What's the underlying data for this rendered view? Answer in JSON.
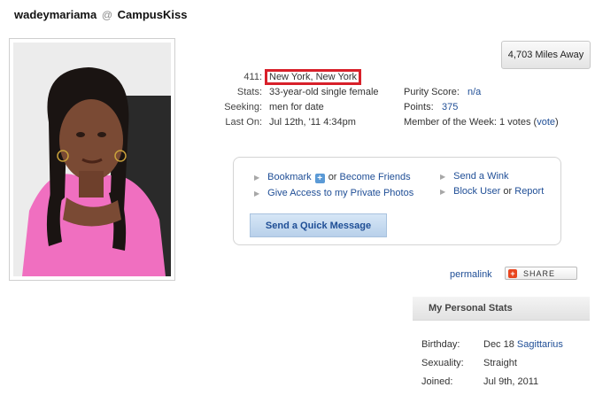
{
  "header": {
    "username": "wadeymariama",
    "at": "@",
    "site": "CampusKiss"
  },
  "distance_button": "4,703 Miles Away",
  "profile": {
    "location_label": "411:",
    "location": "New York, New York",
    "stats_label": "Stats:",
    "stats": "33-year-old single female",
    "seeking_label": "Seeking:",
    "seeking": "men for date",
    "last_on_label": "Last On:",
    "last_on": "Jul 12th, '11 4:34pm",
    "purity_label": "Purity Score:",
    "purity": "n/a",
    "points_label": "Points:",
    "points": "375",
    "motw_label": "Member of the Week:",
    "motw_votes": "1 votes (",
    "motw_vote_link": "vote",
    "motw_close": ")"
  },
  "actions": {
    "bookmark": "Bookmark",
    "or_text": "or",
    "become_friends": "Become Friends",
    "give_access": "Give Access to my Private Photos",
    "send_wink": "Send a Wink",
    "block_user": "Block User",
    "or_text2": "or",
    "report": "Report",
    "quick_message": "Send a Quick Message"
  },
  "permalink": "permalink",
  "share": "SHARE",
  "personal_stats": {
    "title": "My Personal Stats",
    "birthday_label": "Birthday:",
    "birthday": "Dec 18",
    "zodiac": "Sagittarius",
    "sexuality_label": "Sexuality:",
    "sexuality": "Straight",
    "joined_label": "Joined:",
    "joined": "Jul 9th, 2011"
  },
  "colors": {
    "link": "#1f4e96",
    "highlight": "#d8202a",
    "button_blue": "#b8d0ea"
  }
}
